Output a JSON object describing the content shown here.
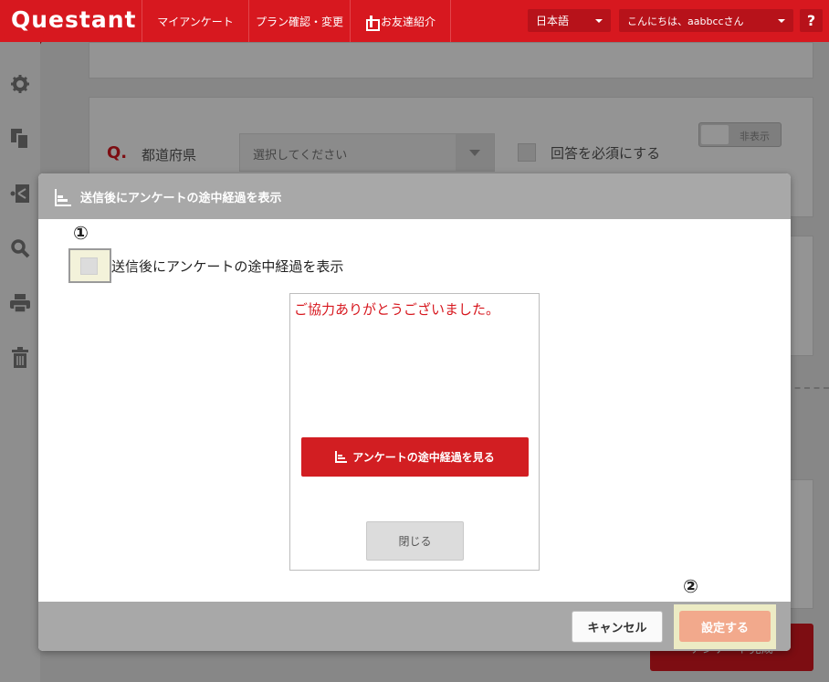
{
  "header": {
    "logo": "Questant",
    "nav": [
      "マイアンケート",
      "プラン確認・変更",
      "お友達紹介"
    ],
    "language": "日本語",
    "greeting": "こんにちは、aabbccさん",
    "help_label": "?"
  },
  "sidebar": {
    "icons": [
      "gear-icon",
      "copy-icon",
      "share-icon",
      "search-icon",
      "print-icon",
      "trash-icon"
    ]
  },
  "background": {
    "question_marker": "Q.",
    "question_label": "都道府県",
    "select_placeholder": "選択してください",
    "required_label": "回答を必須にする",
    "toggle_label": "非表示",
    "primary_button": "アンケート完成"
  },
  "modal": {
    "title": "送信後にアンケートの途中経過を表示",
    "marker_1": "①",
    "marker_2": "②",
    "option_label": "送信後にアンケートの途中経過を表示",
    "option_checked": false,
    "preview": {
      "thanks_text": "ご協力ありがとうございました。",
      "view_results_button": "アンケートの途中経過を見る",
      "close_button": "閉じる"
    },
    "cancel_button": "キャンセル",
    "confirm_button": "設定する"
  },
  "colors": {
    "brand_red": "#d7181f",
    "modal_header": "#a8a8a8",
    "confirm_button": "#f2a98c",
    "highlight": "#f3f2da"
  }
}
